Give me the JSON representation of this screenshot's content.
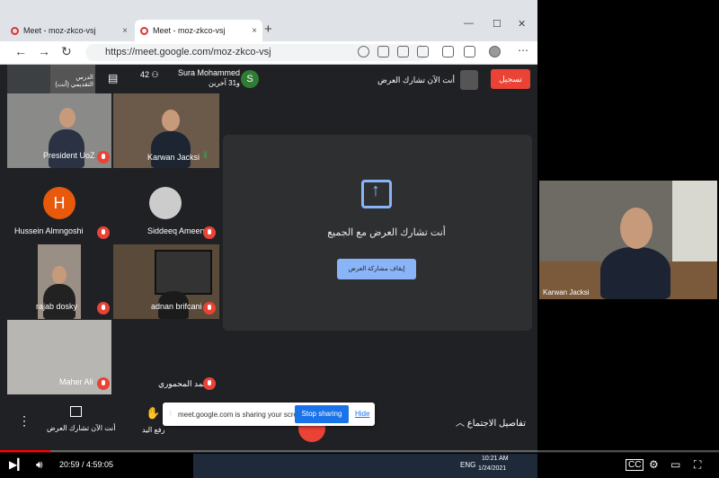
{
  "browser": {
    "tabs": [
      {
        "label": "Meet - moz-zkco-vsj",
        "close": "×"
      },
      {
        "label": "Meet - moz-zkco-vsj",
        "close": "×"
      }
    ],
    "new_tab": "+",
    "url": "https://meet.google.com/moz-zkco-vsj",
    "window_controls": [
      "—",
      "☐",
      "✕"
    ],
    "nav": {
      "back": "←",
      "forward": "→",
      "reload": "↻"
    }
  },
  "meet": {
    "top_name": "Sura Mohammed",
    "top_sub": "و31 آخرين",
    "top_avatar": "S",
    "chat_count": "42",
    "top_mini_name": "الدرس التقديمي (أنت)",
    "presenting_text": "أنت الآن تشارك العرض",
    "record_label": "تسجيل",
    "participants": [
      {
        "name": "President UoZ"
      },
      {
        "name": "Karwan Jacksi"
      },
      {
        "name": "Hussein Almngoshi",
        "avatar": "H"
      },
      {
        "name": "Siddeeq Ameen"
      },
      {
        "name": "rajab dosky"
      },
      {
        "name": "adnan brifcani"
      },
      {
        "name": "Maher Ali"
      },
      {
        "name": "محمد المحموري"
      }
    ],
    "share_title": "أنت تشارك العرض مع الجميع",
    "stop_share_btn": "إيقاف مشاركة العرض",
    "bottom": {
      "present_label": "أنت الآن تشارك العرض",
      "raise_hand": "رفع اليد",
      "details": "تفاصيل الاجتماع"
    },
    "popup": {
      "text": "meet.google.com is sharing your screen.",
      "stop": "Stop sharing",
      "hide": "Hide"
    },
    "self_view_name": "Karwan Jacksi"
  },
  "player": {
    "time": "20:59 / 4:59:05",
    "progress": 0.07,
    "taskbar_lang": "ENG",
    "clock_time": "10:21 AM",
    "clock_date": "1/24/2021"
  },
  "colors": {
    "red": "#ea4335",
    "blue": "#1a73e8",
    "meet_bg": "#202124"
  }
}
